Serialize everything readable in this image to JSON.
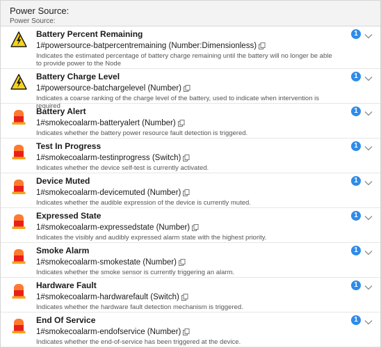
{
  "header": {
    "title": "Power Source:",
    "subtitle": "Power Source:"
  },
  "items": [
    {
      "icon": "warning-icon",
      "name": "Battery Percent Remaining",
      "id": "1#powersource-batpercentremaining (Number:Dimensionless)",
      "desc": "Indicates the estimated percentage of battery charge remaining until the battery will no longer be able to provide power to the Node",
      "count": "1"
    },
    {
      "icon": "warning-icon",
      "name": "Battery Charge Level",
      "id": "1#powersource-batchargelevel (Number)",
      "desc": "Indicates a coarse ranking of the charge level of the battery, used to indicate when intervention is required",
      "count": "1"
    },
    {
      "icon": "alarm-light-icon",
      "name": "Battery Alert",
      "id": "1#smokecoalarm-batteryalert (Number)",
      "desc": "Indicates whether the battery power resource fault detection is triggered.",
      "count": "1"
    },
    {
      "icon": "alarm-light-icon",
      "name": "Test In Progress",
      "id": "1#smokecoalarm-testinprogress (Switch)",
      "desc": "Indicates whether the device self-test is currently activated.",
      "count": "1"
    },
    {
      "icon": "alarm-light-icon",
      "name": "Device Muted",
      "id": "1#smokecoalarm-devicemuted (Number)",
      "desc": "Indicates whether the audible expression of the device is currently muted.",
      "count": "1"
    },
    {
      "icon": "alarm-light-icon",
      "name": "Expressed State",
      "id": "1#smokecoalarm-expressedstate (Number)",
      "desc": "Indicates the visibly and audibly expressed alarm state with the highest priority.",
      "count": "1"
    },
    {
      "icon": "alarm-light-icon",
      "name": "Smoke Alarm",
      "id": "1#smokecoalarm-smokestate (Number)",
      "desc": "Indicates whether the smoke sensor is currently triggering an alarm.",
      "count": "1"
    },
    {
      "icon": "alarm-light-icon",
      "name": "Hardware Fault",
      "id": "1#smokecoalarm-hardwarefault (Switch)",
      "desc": "Indicates whether the hardware fault detection mechanism is triggered.",
      "count": "1"
    },
    {
      "icon": "alarm-light-icon",
      "name": "End Of Service",
      "id": "1#smokecoalarm-endofservice (Number)",
      "desc": "Indicates whether the end-of-service has been triggered at the device.",
      "count": "1"
    }
  ],
  "colors": {
    "badge": "#2f8be8",
    "warning": "#f6d21c",
    "alarm_top": "#ff7a2c",
    "alarm_body": "#e8201b"
  }
}
